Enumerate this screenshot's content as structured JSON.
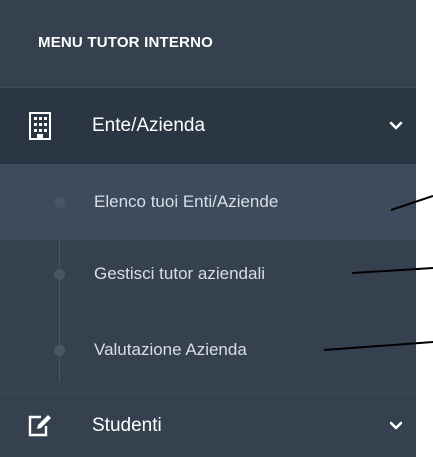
{
  "sidebar": {
    "heading": "MENU TUTOR INTERNO",
    "items": [
      {
        "label": "Ente/Azienda",
        "icon": "building-icon",
        "expanded": true,
        "submenu": [
          {
            "label": "Elenco tuoi Enti/Aziende"
          },
          {
            "label": "Gestisci tutor aziendali"
          },
          {
            "label": "Valutazione Azienda"
          }
        ]
      },
      {
        "label": "Studenti",
        "icon": "edit-icon",
        "expanded": false
      }
    ]
  },
  "colors": {
    "sidebar_bg": "#364150",
    "active_bg": "#2b3643",
    "highlight_bg": "#3e4b5c",
    "text": "#ffffff"
  }
}
